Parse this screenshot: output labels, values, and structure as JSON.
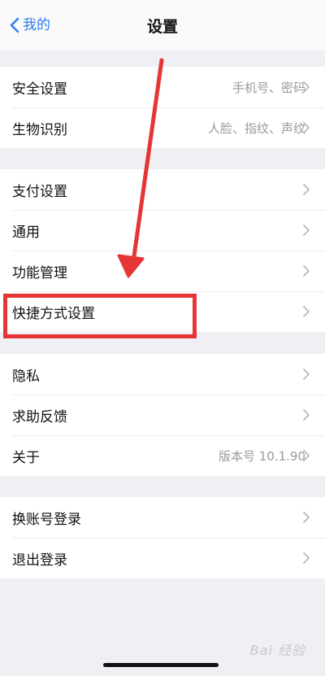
{
  "nav": {
    "back_label": "我的",
    "title": "设置"
  },
  "groups": [
    {
      "rows": [
        {
          "label": "安全设置",
          "value": "手机号、密码"
        },
        {
          "label": "生物识别",
          "value": "人脸、指纹、声纹"
        }
      ]
    },
    {
      "rows": [
        {
          "label": "支付设置",
          "value": ""
        },
        {
          "label": "通用",
          "value": ""
        },
        {
          "label": "功能管理",
          "value": ""
        },
        {
          "label": "快捷方式设置",
          "value": ""
        }
      ]
    },
    {
      "rows": [
        {
          "label": "隐私",
          "value": ""
        },
        {
          "label": "求助反馈",
          "value": ""
        },
        {
          "label": "关于",
          "value": "版本号 10.1.90"
        }
      ]
    },
    {
      "rows": [
        {
          "label": "换账号登录",
          "value": ""
        },
        {
          "label": "退出登录",
          "value": ""
        }
      ]
    }
  ],
  "colors": {
    "accent": "#2d7cf6",
    "annotation": "#e53535"
  },
  "watermark": "Bai 经验"
}
